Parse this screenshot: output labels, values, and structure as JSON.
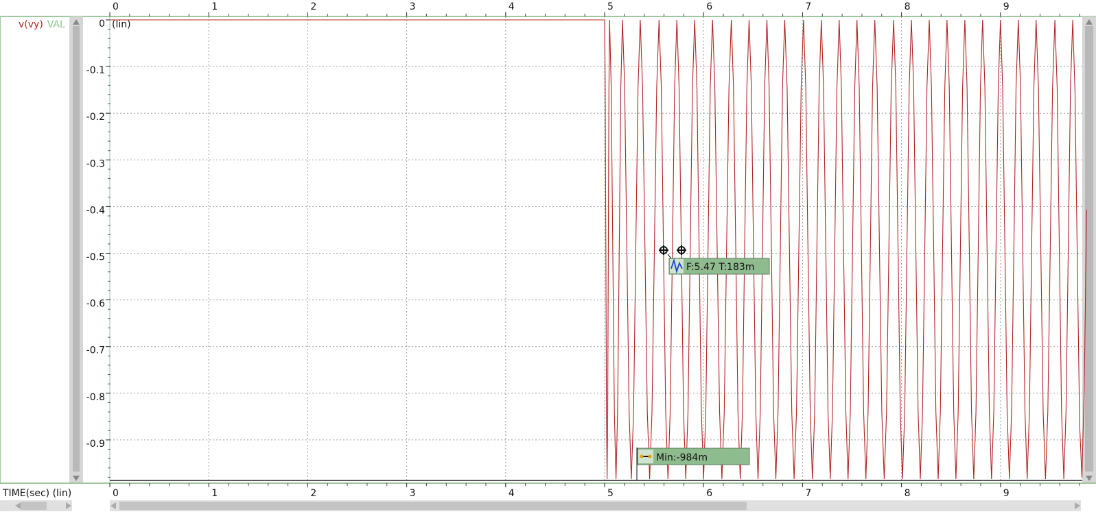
{
  "chart_data": {
    "type": "line",
    "series": [
      {
        "name": "v(vy)",
        "color": "#b22222",
        "description_shape": "flat at 0 until x=5, then oscillation between 0 and about -0.984 with slightly increasing frequency",
        "x": [
          0,
          5
        ],
        "y": [
          0,
          0
        ]
      }
    ],
    "xlim": [
      0,
      9.85
    ],
    "ylim": [
      -0.99,
      0.01
    ],
    "x_ticks": [
      0,
      1,
      2,
      3,
      4,
      5,
      6,
      7,
      8,
      9
    ],
    "y_ticks": [
      0,
      -0.1,
      -0.2,
      -0.3,
      -0.4,
      -0.5,
      -0.6,
      -0.7,
      -0.8,
      -0.9
    ],
    "xlabel": "TIME(sec) (lin)",
    "y_scale_tag": "(lin)",
    "grid": true,
    "legend": {
      "signal": "v(vy)",
      "value_prefix": "VAL"
    }
  },
  "markers": {
    "frequency": {
      "label": "F:5.47 T:183m",
      "icon": "sine-wave-icon"
    },
    "minimum": {
      "label": "Min:-984m",
      "icon": "min-bar-icon"
    }
  },
  "colors": {
    "trace": "#b22222",
    "grid": "#9a9a9a",
    "marker_bg": "#8fbc8f",
    "frame": "#9ec89e"
  },
  "oscillation": {
    "start_time": 5.0,
    "min_value": -0.984,
    "peaks_at": [
      5.05,
      5.18,
      5.36,
      5.55,
      5.73,
      5.91,
      6.09,
      6.28,
      6.46,
      6.64,
      6.82,
      7.01,
      7.19,
      7.37,
      7.55,
      7.73,
      7.92,
      8.1,
      8.28,
      8.46,
      8.64,
      8.82,
      9.0,
      9.18,
      9.36,
      9.55,
      9.73
    ]
  }
}
